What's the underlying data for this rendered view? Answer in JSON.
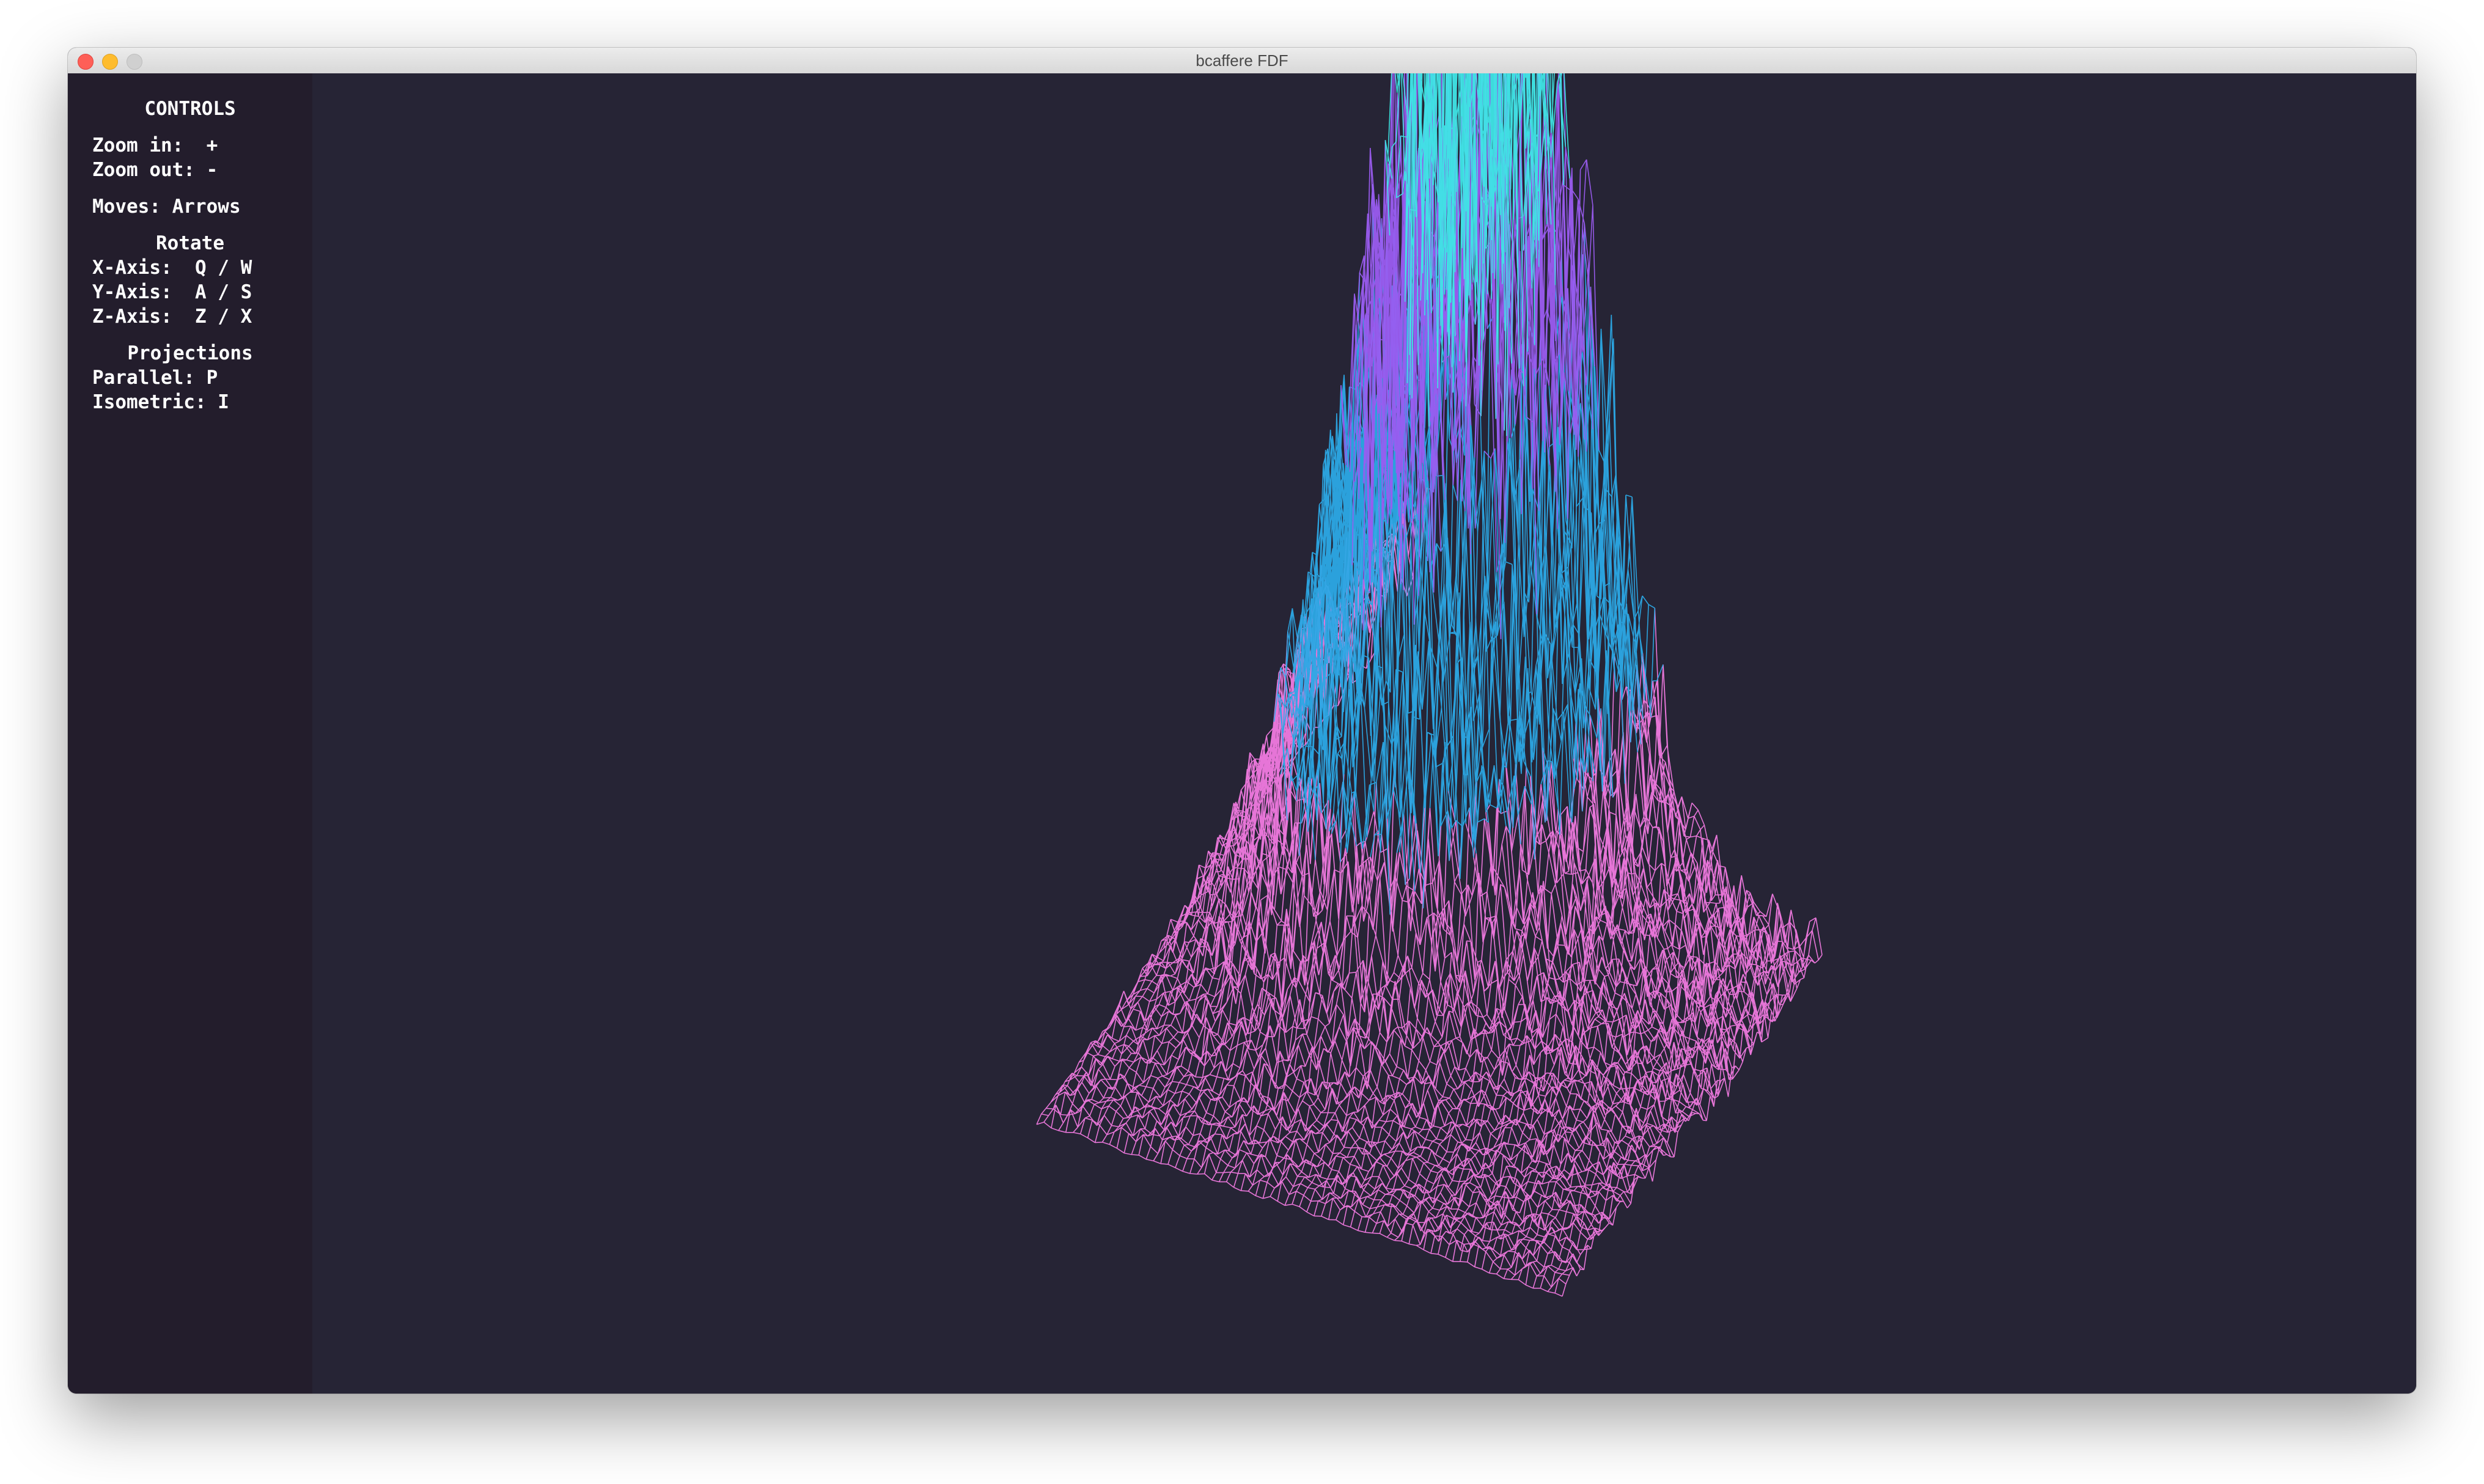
{
  "window": {
    "title": "bcaffere FDF"
  },
  "controls": {
    "heading": "CONTROLS",
    "zoom_in": "Zoom in:  +",
    "zoom_out": "Zoom out: -",
    "moves": "Moves: Arrows",
    "rotate_heading": "Rotate",
    "x_axis": "X-Axis:  Q / W",
    "y_axis": "Y-Axis:  A / S",
    "z_axis": "Z-Axis:  Z / X",
    "projections_heading": "Projections",
    "parallel": "Parallel: P",
    "isometric": "Isometric: I"
  },
  "colors": {
    "background": "#262435",
    "sidebar": "#231d2c",
    "low": "#f07ae0",
    "mid": "#2ba9e6",
    "high": "#9a5cf0",
    "peak": "#3ee6e6"
  }
}
